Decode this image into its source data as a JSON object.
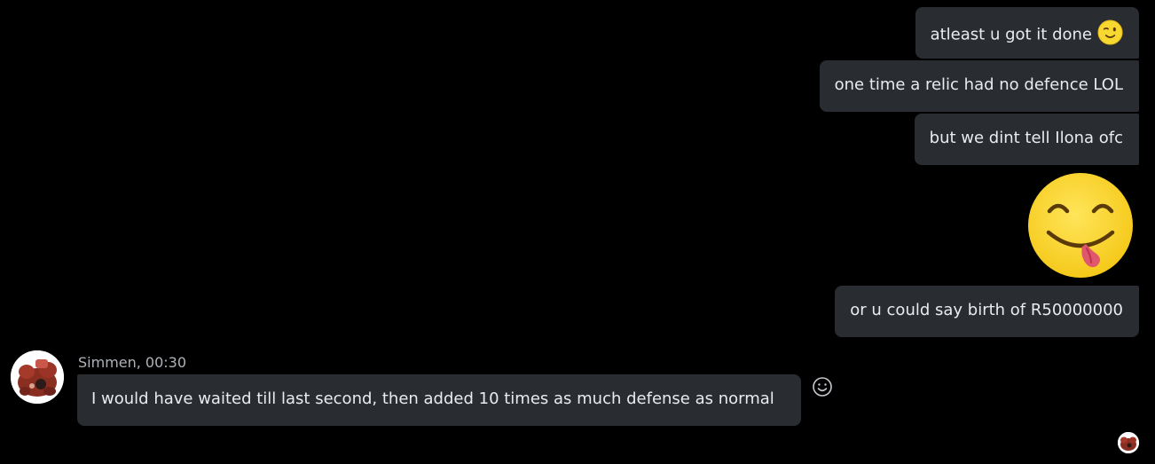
{
  "outgoing": [
    {
      "text": "atleast u got it done",
      "emoji": "winking-face-emoji"
    },
    {
      "text": "one time a relic had no defence LOL"
    },
    {
      "text": "but we dint tell Ilona ofc"
    },
    {
      "sticker": "face-savoring-food-emoji"
    },
    {
      "text": "or u could say birth of R50000000"
    }
  ],
  "incoming": {
    "sender": "Simmen",
    "time": "00:30",
    "sender_line": "Simmen, 00:30",
    "text": "I would have waited till last second, then added 10 times as much defense as normal",
    "reaction_icon": "smiley-reaction-icon"
  },
  "seen_indicator": "read-receipt-avatar",
  "colors": {
    "background": "#000000",
    "bubble": "#292d32",
    "text": "#e9ebee",
    "meta_text": "#aeb3b9",
    "emoji_yellow": "#f7d830"
  }
}
